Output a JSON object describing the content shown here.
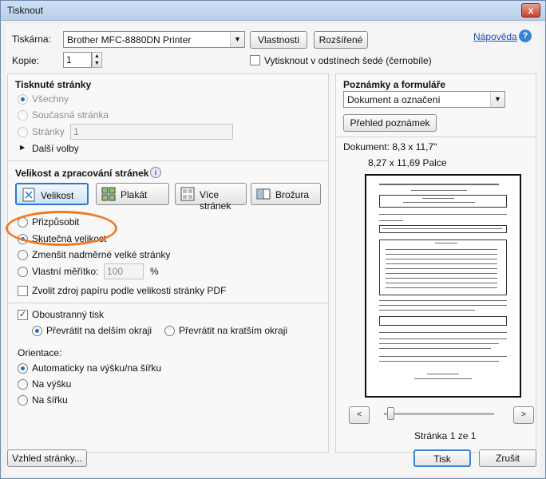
{
  "window": {
    "title": "Tisknout",
    "close_label": "x"
  },
  "printer": {
    "label": "Tiskárna:",
    "selected": "Brother MFC-8880DN Printer",
    "properties_button": "Vlastnosti",
    "advanced_button": "Rozšířené",
    "help_link": "Nápověda",
    "copies_label": "Kopie:",
    "copies_value": "1",
    "grayscale_label": "Vytisknout v odstínech šedé (černobíle)"
  },
  "pages": {
    "title": "Tisknuté stránky",
    "all": "Všechny",
    "current": "Současná stránka",
    "pages_label": "Stránky",
    "pages_value": "1",
    "more_options": "Další volby"
  },
  "sizing": {
    "title": "Velikost a zpracování stránek",
    "info_icon": "i",
    "buttons": [
      "Velikost",
      "Plakát",
      "Více stránek",
      "Brožura"
    ],
    "fit": "Přizpůsobit",
    "actual": "Skutečná velikost",
    "shrink": "Zmenšit nadměrné velké stránky",
    "custom_scale": "Vlastní měřítko:",
    "custom_scale_value": "100",
    "percent": "%",
    "paper_source": "Zvolit zdroj papíru podle velikosti stránky PDF"
  },
  "duplex": {
    "label": "Oboustranný tisk",
    "long_edge": "Převrátit na delším okraji",
    "short_edge": "Převrátit na kratším okraji"
  },
  "orientation": {
    "title": "Orientace:",
    "auto": "Automaticky na výšku/na šířku",
    "portrait": "Na výšku",
    "landscape": "Na šířku"
  },
  "comments": {
    "title": "Poznámky a formuláře",
    "selected": "Dokument a označení",
    "summarize_button": "Přehled poznámek"
  },
  "preview": {
    "doc_size": "Dokument: 8,3 x 11,7\"",
    "paper_size": "8,27 x 11,69 Palce",
    "page_indicator": "Stránka 1 ze 1",
    "prev_label": "<",
    "next_label": ">"
  },
  "footer": {
    "page_setup": "Vzhled stránky...",
    "print": "Tisk",
    "cancel": "Zrušit"
  }
}
